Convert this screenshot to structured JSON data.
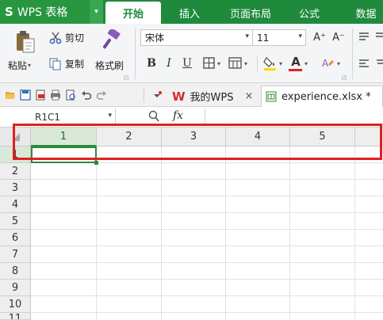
{
  "app": {
    "logo": "S",
    "name": "WPS 表格",
    "menu_caret": "▾"
  },
  "ribbon_tabs": [
    {
      "label": "开始",
      "active": true
    },
    {
      "label": "插入",
      "active": false
    },
    {
      "label": "页面布局",
      "active": false
    },
    {
      "label": "公式",
      "active": false
    },
    {
      "label": "数据",
      "active": false
    }
  ],
  "clipboard": {
    "paste": "粘贴",
    "cut": "剪切",
    "copy": "复制",
    "format_painter": "格式刷"
  },
  "font": {
    "name": "宋体",
    "size": "11",
    "grow": "A⁺",
    "shrink": "A⁻",
    "bold": "B",
    "italic": "I",
    "underline": "U",
    "font_color_letter": "A"
  },
  "colors": {
    "brand_green": "#1f8a3c",
    "selection_green": "#2e8b3e",
    "annotation_red": "#e0201f",
    "fill_yellow": "#ffd800",
    "font_red": "#e02020",
    "wps_red": "#d7282e"
  },
  "doc_tabs": [
    {
      "icon": "wps-logo-icon",
      "label": "我的WPS",
      "close": "×"
    },
    {
      "icon": "excel-file-icon",
      "label": "experience.xlsx *",
      "close": ""
    }
  ],
  "formula_bar": {
    "name_box": "R1C1",
    "fx": "fx"
  },
  "grid": {
    "columns": [
      "1",
      "2",
      "3",
      "4",
      "5"
    ],
    "rows": [
      "1",
      "2",
      "3",
      "4",
      "5",
      "6",
      "7",
      "8",
      "9",
      "10",
      "11"
    ],
    "selected_cell": "R1C1"
  }
}
